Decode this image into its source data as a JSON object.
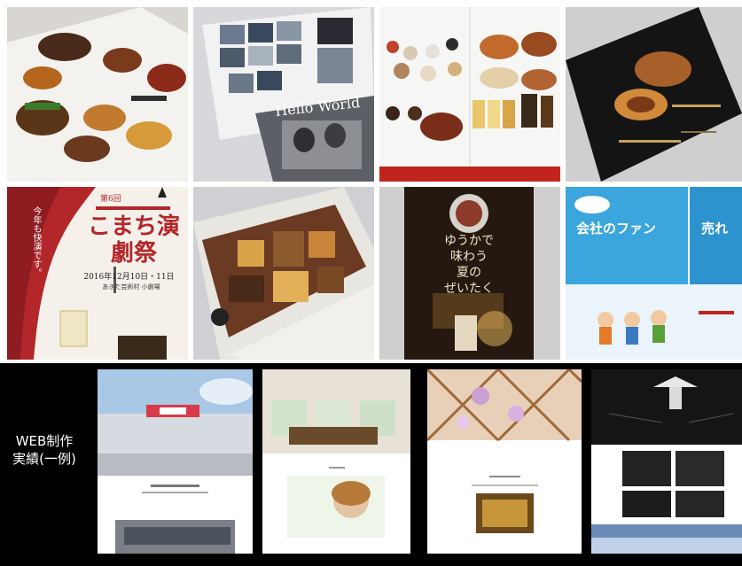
{
  "portfolio": {
    "print_samples": [
      {
        "id": "food-menu-brochure",
        "icon": "menu-brochure-photo"
      },
      {
        "id": "hello-world-brochure",
        "text": "Hello World"
      },
      {
        "id": "food-product-catalog",
        "icon": "catalog-spread-photo"
      },
      {
        "id": "dark-food-flyer",
        "icon": "dark-flyer-photo"
      },
      {
        "id": "theater-festival-poster",
        "title": "こまち演劇祭",
        "edition": "第6回",
        "date_line": "2016年12月10日・11日",
        "venue": "あきた芸術村 小劇場",
        "side_text": "今年も快演です。"
      },
      {
        "id": "folded-leaflet",
        "icon": "leaflet-photo"
      },
      {
        "id": "summer-night-poster",
        "line1": "ゆうかで",
        "line2": "味わう",
        "line3": "夏の",
        "line4": "ぜいたく"
      },
      {
        "id": "company-fan-brochure",
        "headline": "会社のファン",
        "headline_right": "売れ"
      }
    ],
    "web": {
      "label_line1": "WEB制作",
      "label_line2": "実績(一例)"
    }
  },
  "colors": {
    "band": "#000000",
    "label": "#ffffff",
    "poster_red": "#b3262a",
    "sky_blue": "#3aa6dd"
  }
}
